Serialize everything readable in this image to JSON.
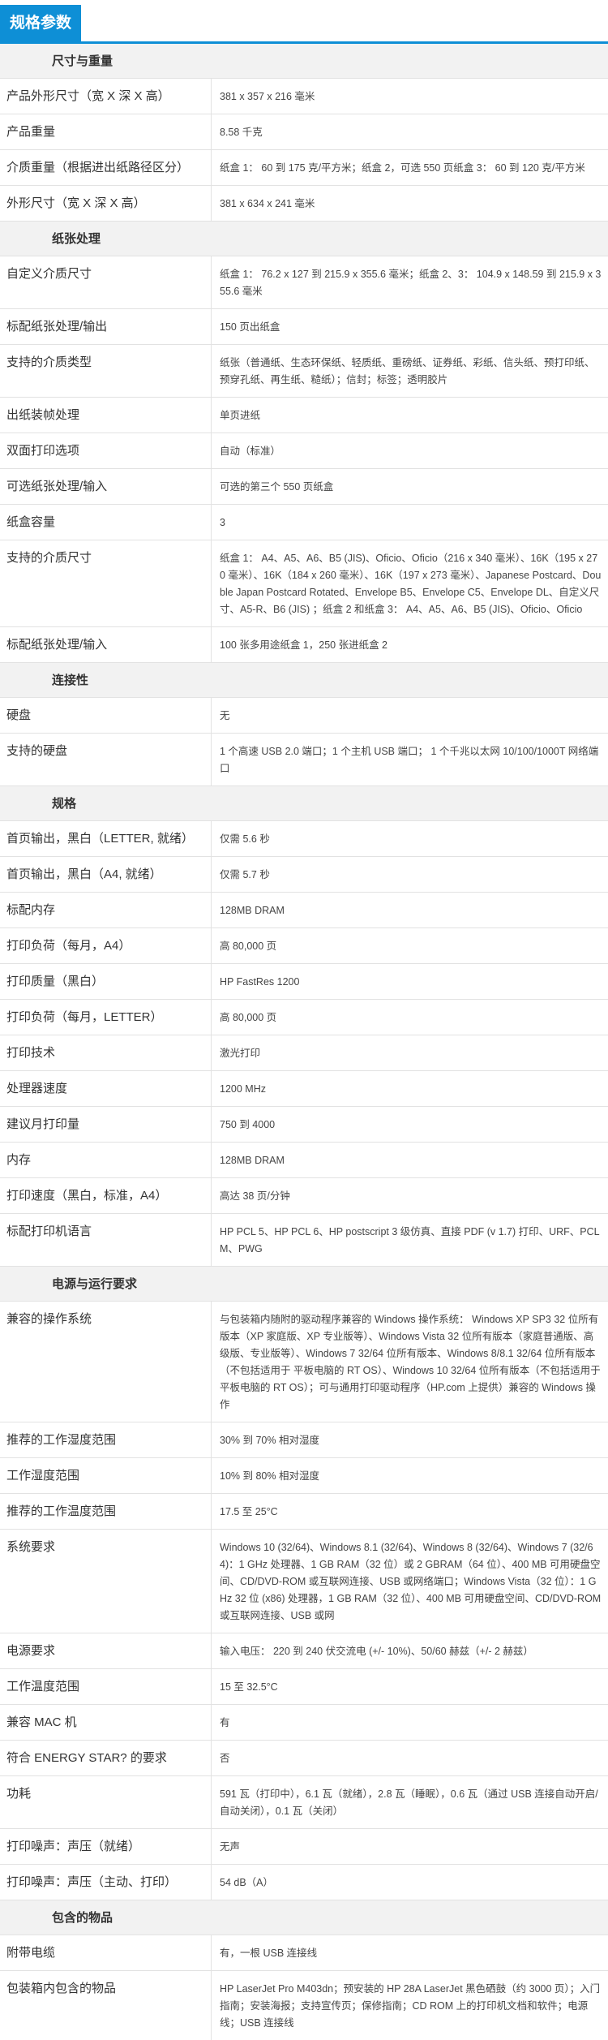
{
  "title": "规格参数",
  "sections": [
    {
      "header": "尺寸与重量",
      "rows": [
        {
          "label": "产品外形尺寸（宽 X 深 X 高）",
          "value": "381 x 357 x 216 毫米"
        },
        {
          "label": "产品重量",
          "value": "8.58 千克"
        },
        {
          "label": "介质重量（根据进出纸路径区分）",
          "value": "纸盒 1： 60 到 175 克/平方米；纸盒 2，可选 550 页纸盒 3： 60 到 120 克/平方米"
        },
        {
          "label": "外形尺寸（宽 X 深 X 高）",
          "value": "381 x 634 x 241 毫米"
        }
      ]
    },
    {
      "header": "纸张处理",
      "rows": [
        {
          "label": "自定义介质尺寸",
          "value": "纸盒 1： 76.2 x 127 到 215.9 x 355.6 毫米；纸盒 2、3： 104.9 x 148.59 到 215.9 x 355.6 毫米"
        },
        {
          "label": "标配纸张处理/输出",
          "value": "150 页出纸盒"
        },
        {
          "label": "支持的介质类型",
          "value": "纸张（普通纸、生态环保纸、轻质纸、重磅纸、证券纸、彩纸、信头纸、预打印纸、预穿孔纸、再生纸、糙纸）；信封；标签；透明胶片"
        },
        {
          "label": "出纸装帧处理",
          "value": "单页进纸"
        },
        {
          "label": "双面打印选项",
          "value": "自动（标准）"
        },
        {
          "label": "可选纸张处理/输入",
          "value": "可选的第三个 550 页纸盒"
        },
        {
          "label": "纸盒容量",
          "value": "3"
        },
        {
          "label": "支持的介质尺寸",
          "value": "纸盒 1： A4、A5、A6、B5 (JIS)、Oficio、Oficio（216 x 340 毫米）、16K（195 x 270 毫米）、16K（184 x 260 毫米）、16K（197 x 273 毫米）、Japanese Postcard、Double Japan Postcard Rotated、Envelope B5、Envelope C5、Envelope DL、自定义尺寸、A5-R、B6 (JIS) ；纸盒 2 和纸盒 3： A4、A5、A6、B5 (JIS)、Oficio、Oficio"
        },
        {
          "label": "标配纸张处理/输入",
          "value": "100 张多用途纸盒 1，250 张进纸盒 2"
        }
      ]
    },
    {
      "header": "连接性",
      "rows": [
        {
          "label": "硬盘",
          "value": "无"
        },
        {
          "label": "支持的硬盘",
          "value": "1 个高速 USB 2.0 端口；1 个主机 USB 端口； 1 个千兆以太网 10/100/1000T 网络端口"
        }
      ]
    },
    {
      "header": "规格",
      "rows": [
        {
          "label": "首页输出，黑白（LETTER, 就绪）",
          "value": "仅需 5.6 秒"
        },
        {
          "label": "首页输出，黑白（A4, 就绪）",
          "value": "仅需 5.7 秒"
        },
        {
          "label": "标配内存",
          "value": "128MB DRAM"
        },
        {
          "label": "打印负荷（每月，A4）",
          "value": "高 80,000 页"
        },
        {
          "label": "打印质量（黑白）",
          "value": "HP FastRes 1200"
        },
        {
          "label": "打印负荷（每月，LETTER）",
          "value": "高 80,000 页"
        },
        {
          "label": "打印技术",
          "value": "激光打印"
        },
        {
          "label": "处理器速度",
          "value": "1200 MHz"
        },
        {
          "label": "建议月打印量",
          "value": "750 到 4000"
        },
        {
          "label": "内存",
          "value": "128MB DRAM"
        },
        {
          "label": "打印速度（黑白，标准，A4）",
          "value": "高达 38 页/分钟"
        },
        {
          "label": "标配打印机语言",
          "value": "HP PCL 5、HP PCL 6、HP postscript 3 级仿真、直接 PDF (v 1.7) 打印、URF、PCLM、PWG"
        }
      ]
    },
    {
      "header": "电源与运行要求",
      "rows": [
        {
          "label": "兼容的操作系统",
          "value": "与包装箱内随附的驱动程序兼容的 Windows 操作系统： Windows XP SP3 32 位所有版本（XP 家庭版、XP 专业版等）、Windows Vista 32 位所有版本（家庭普通版、高级版、专业版等）、Windows 7 32/64 位所有版本、Windows 8/8.1 32/64 位所有版本（不包括适用于 平板电脑的 RT OS）、Windows 10 32/64 位所有版本（不包括适用于平板电脑的 RT OS）；可与通用打印驱动程序（HP.com 上提供）兼容的 Windows 操作"
        },
        {
          "label": "推荐的工作湿度范围",
          "value": "30% 到 70% 相对湿度"
        },
        {
          "label": "工作湿度范围",
          "value": "10% 到 80% 相对湿度"
        },
        {
          "label": "推荐的工作温度范围",
          "value": "17.5 至 25°C"
        },
        {
          "label": "系统要求",
          "value": "Windows 10 (32/64)、Windows 8.1 (32/64)、Windows 8 (32/64)、Windows 7 (32/64)：1 GHz 处理器、1 GB RAM（32 位）或 2 GBRAM（64 位）、400 MB 可用硬盘空间、CD/DVD-ROM 或互联网连接、USB 或网络端口；Windows Vista（32 位）：1 GHz 32 位 (x86) 处理器，1 GB RAM（32 位）、400 MB 可用硬盘空间、CD/DVD-ROM 或互联网连接、USB 或网"
        },
        {
          "label": "电源要求",
          "value": "输入电压： 220 到 240 伏交流电 (+/- 10%)、50/60 赫兹（+/- 2 赫兹）"
        },
        {
          "label": "工作温度范围",
          "value": "15 至 32.5°C"
        },
        {
          "label": "兼容 MAC 机",
          "value": "有"
        },
        {
          "label": "符合 ENERGY STAR? 的要求",
          "value": "否"
        },
        {
          "label": "功耗",
          "value": "591 瓦（打印中），6.1 瓦（就绪），2.8 瓦（睡眠），0.6 瓦（通过 USB 连接自动开启/自动关闭），0.1 瓦（关闭）"
        },
        {
          "label": "打印噪声：声压（就绪）",
          "value": "无声"
        },
        {
          "label": "打印噪声：声压（主动、打印）",
          "value": "54 dB（A）"
        }
      ]
    },
    {
      "header": "包含的物品",
      "rows": [
        {
          "label": "附带电缆",
          "value": "有，一根 USB 连接线"
        },
        {
          "label": "包装箱内包含的物品",
          "value": "HP LaserJet Pro M403dn；预安装的 HP 28A LaserJet 黑色硒鼓（约 3000 页）；入门指南；安装海报；支持宣传页；保修指南；CD ROM 上的打印机文档和软件；电源线；USB 连接线"
        }
      ]
    }
  ]
}
